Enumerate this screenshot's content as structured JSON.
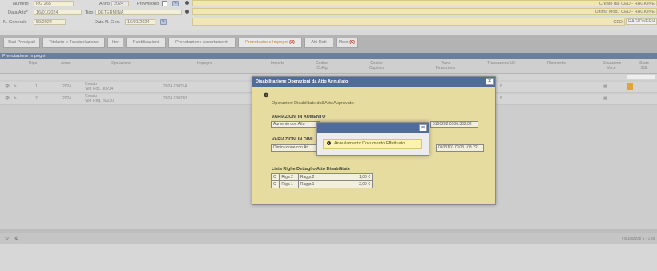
{
  "header": {
    "numero_label": "Numero",
    "numero_value": "RG 265",
    "anno_label": "Anno",
    "anno_value": "2024",
    "provvisorio_label": "Provvisorio",
    "data_atto_label": "Data Atto*",
    "data_atto_value": "16/01/2024",
    "tipo_label": "Tipo",
    "tipo_value": "DETERMINA",
    "ngenerale_label": "N. Generale",
    "ngenerale_value": "59/2024",
    "data_ngen_label": "Data N. Gen.",
    "data_ngen_value": "16/01/2024",
    "creato_da": "Creato da: CED - RAGIONE",
    "ultima_mod": "Ultima Mod.: CED - RAGIONE",
    "ced_label": "CED",
    "ced_value": "RAGIONERIA"
  },
  "tabs": [
    {
      "label": "Dati Principali",
      "active": false
    },
    {
      "label": "Titolario e Fascicolazione",
      "active": false
    },
    {
      "label": "Iter",
      "active": false
    },
    {
      "label": "Pubblicazioni",
      "active": false
    },
    {
      "label": "Prenotazione Accertamenti",
      "active": false
    },
    {
      "label": "Prenotazione Impegni",
      "badge": "(2)",
      "active": true
    },
    {
      "label": "Atti Dati",
      "active": false
    },
    {
      "label": "Note",
      "badge": "(0)",
      "active": false
    }
  ],
  "section_title": "Prenotazione Impegni",
  "grid": {
    "columns": [
      "Rigo",
      "Anno",
      "Operazione",
      "Impegno",
      "Importo",
      "Codice CoFig",
      "Codice Capitolo",
      "Piano Finanziario",
      "Transazione UE",
      "Ricorrente",
      "Situazione Voce",
      "Stato SSL"
    ],
    "rows": [
      {
        "rigo": "1",
        "anno": "2024",
        "operazione": [
          "Creato",
          "Ver. Pos. 30214"
        ],
        "impegno": "2024 / 30214",
        "transazione": "8"
      },
      {
        "rigo": "2",
        "anno": "2024",
        "operazione": [
          "Creato",
          "Ver. Reg. 30230"
        ],
        "impegno": "2024 / 30230",
        "transazione": "8"
      }
    ],
    "footer_text": "Visualizzati 1 - 2 di"
  },
  "dialog_disable": {
    "title": "Disabilitazione Operazioni da Atto Annullato",
    "intro": "Operazioni Disabilitate dall'Atto Approvato:",
    "aumento_heading": "VARIAZIONI IN AUMENTO",
    "aumento_field": "Aumento con Atto",
    "aumento_code": "0106202.0106.302.02",
    "diminuzione_heading": "VARIAZIONI IN DIMI",
    "diminuzione_field": "Diminuzione con Att",
    "diminuzione_code": "0103103.0103.103.22",
    "lista_heading": "Lista Righe Dettaglio Atto Disabilitate",
    "lista_rows": [
      {
        "flag": "C",
        "riga": "Riga 2",
        "raggr": "Raggr.2",
        "importo": "1,00 €"
      },
      {
        "flag": "C",
        "riga": "Riga 1",
        "raggr": "Raggr.1",
        "importo": "2,00 €"
      }
    ]
  },
  "dialog_msg": {
    "message": "Annullamento Documento Effettuato"
  },
  "colors": {
    "accent": "#4f6c9a",
    "dialog_bg": "#e7dca0",
    "message_bg": "#fbf2b0",
    "active_tab_text": "#c08a3a",
    "badge_red": "#c0392b"
  }
}
